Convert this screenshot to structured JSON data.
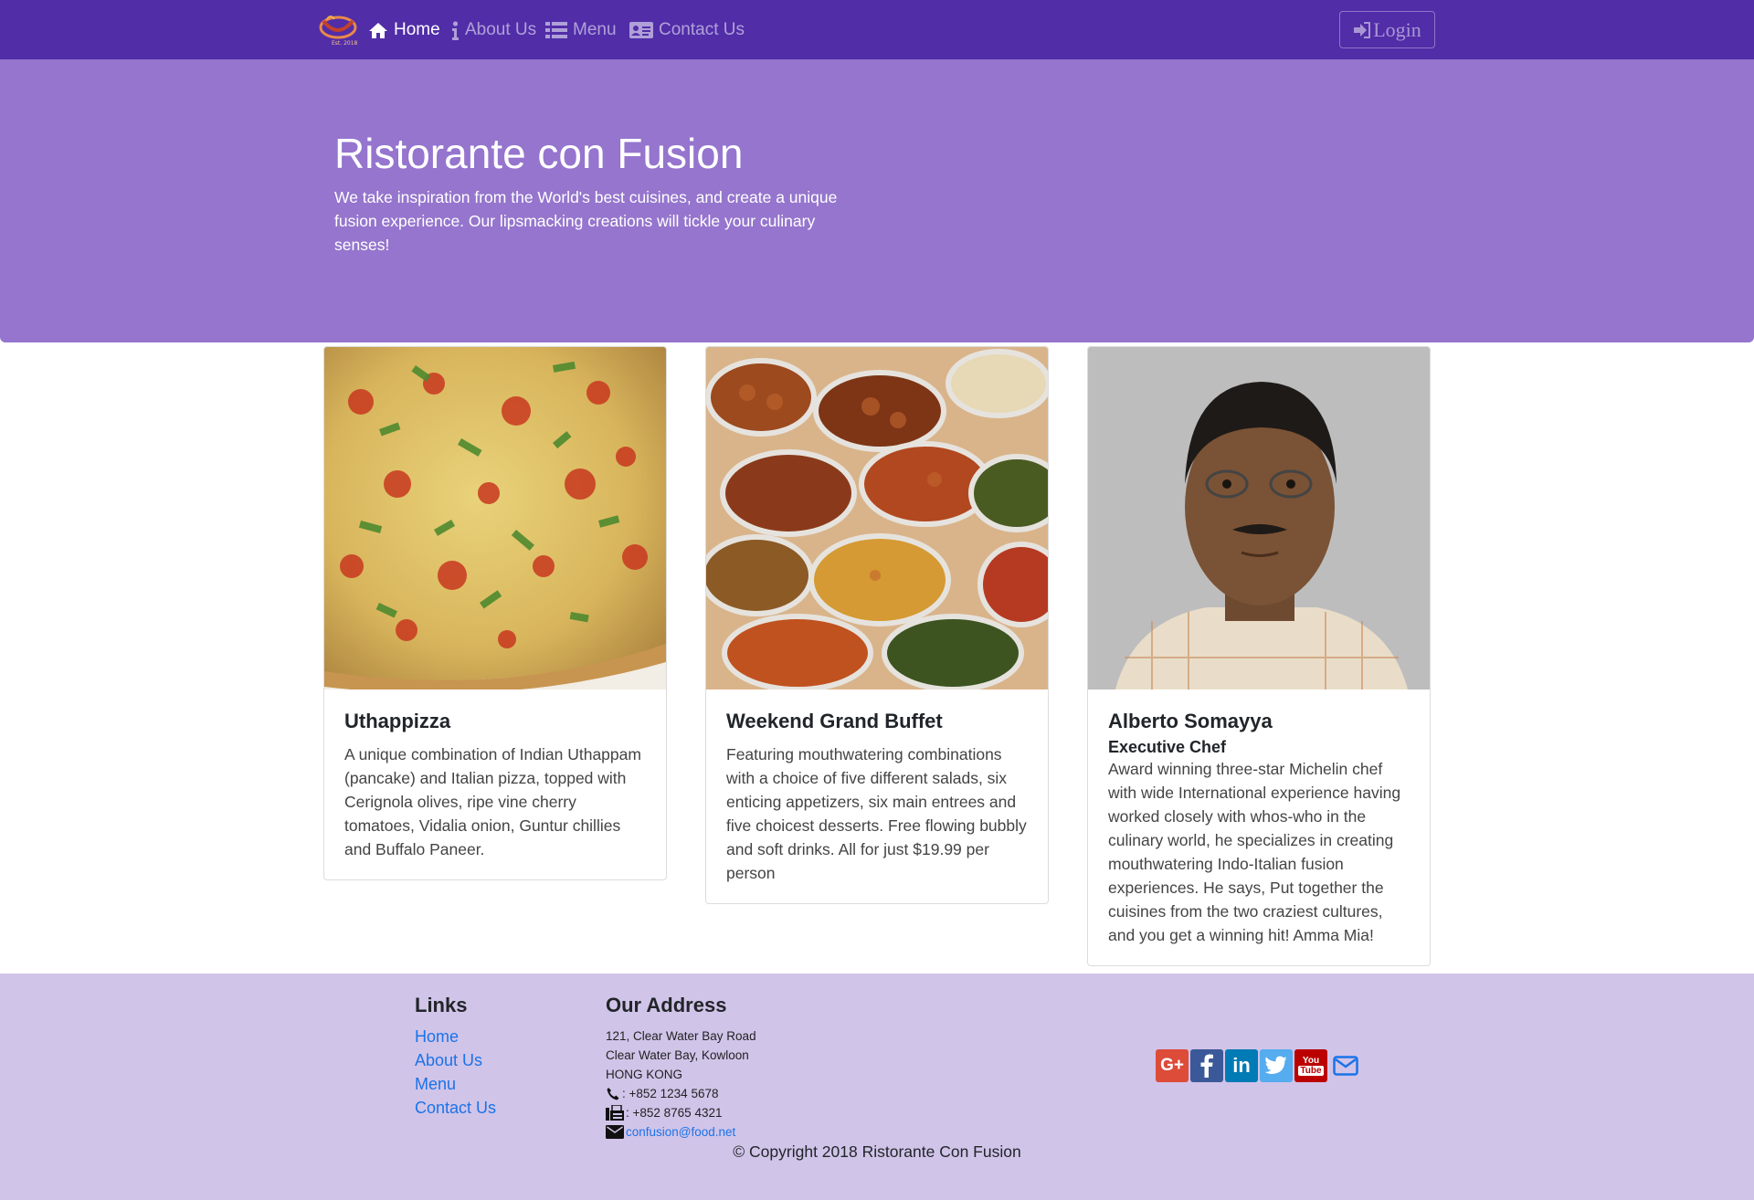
{
  "navbar": {
    "logo_alt": "Ristorante Con Fusion logo",
    "items": [
      {
        "label": "Home",
        "icon": "home-icon",
        "active": true
      },
      {
        "label": "About Us",
        "icon": "info-icon",
        "active": false
      },
      {
        "label": "Menu",
        "icon": "list-icon",
        "active": false
      },
      {
        "label": "Contact Us",
        "icon": "address-card-icon",
        "active": false
      }
    ],
    "login_label": "Login",
    "color": "#512DA8"
  },
  "jumbotron": {
    "title": "Ristorante con Fusion",
    "text": "We take inspiration from the World's best cuisines, and create a unique fusion experience. Our lipsmacking creations will tickle your culinary senses!",
    "color": "#9575CD"
  },
  "cards": [
    {
      "image": "pizza photo",
      "title": "Uthappizza",
      "subtitle": "",
      "text": "A unique combination of Indian Uthappam (pancake) and Italian pizza, topped with Cerignola olives, ripe vine cherry tomatoes, Vidalia onion, Guntur chillies and Buffalo Paneer."
    },
    {
      "image": "buffet photo",
      "title": "Weekend Grand Buffet",
      "subtitle": "",
      "text": "Featuring mouthwatering combinations with a choice of five different salads, six enticing appetizers, six main entrees and five choicest desserts. Free flowing bubbly and soft drinks. All for just $19.99 per person"
    },
    {
      "image": "chef portrait photo",
      "title": "Alberto Somayya",
      "subtitle": "Executive Chef",
      "text": "Award winning three-star Michelin chef with wide International experience having worked closely with whos-who in the culinary world, he specializes in creating mouthwatering Indo-Italian fusion experiences. He says, Put together the cuisines from the two craziest cultures, and you get a winning hit! Amma Mia!"
    }
  ],
  "footer": {
    "links_heading": "Links",
    "links": [
      "Home",
      "About Us",
      "Menu",
      "Contact Us"
    ],
    "address_heading": "Our Address",
    "address_lines": [
      "121, Clear Water Bay Road",
      "Clear Water Bay, Kowloon",
      "HONG KONG"
    ],
    "phone": ": +852 1234 5678",
    "fax": ": +852 8765 4321",
    "email": "confusion@food.net",
    "social": [
      "google-plus-icon",
      "facebook-icon",
      "linkedin-icon",
      "twitter-icon",
      "youtube-icon",
      "envelope-icon"
    ],
    "copyright": "© Copyright 2018 Ristorante Con Fusion",
    "color": "#D1C4E9"
  }
}
